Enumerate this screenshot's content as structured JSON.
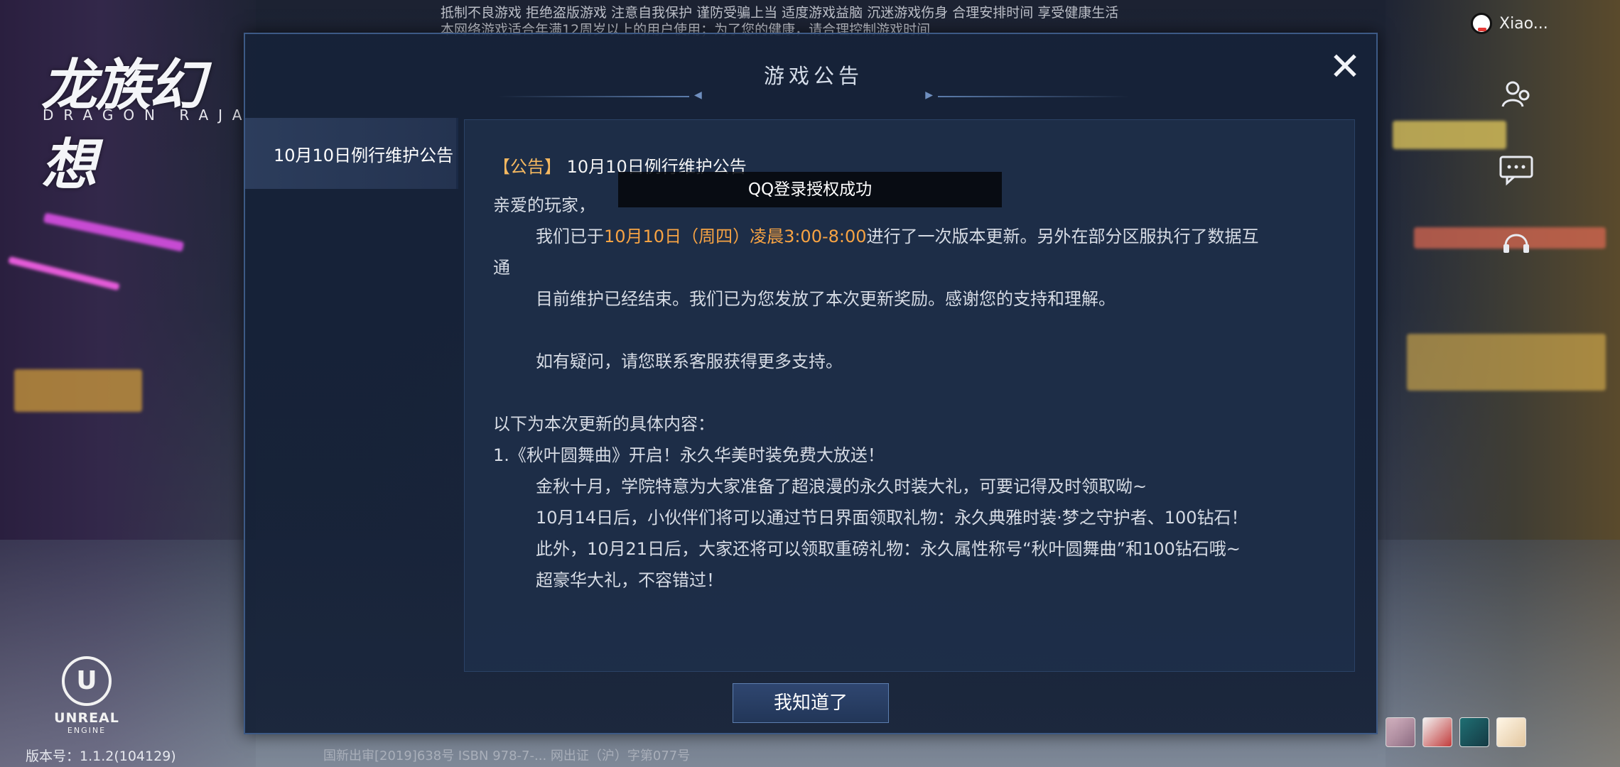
{
  "background": {
    "top_notice_line1": "抵制不良游戏 拒绝盗版游戏 注意自我保护 谨防受骗上当 适度游戏益脑 沉迷游戏伤身 合理安排时间 享受健康生活",
    "top_notice_line2": "本网络游戏适合年满12周岁以上的用户使用；为了您的健康，请合理控制游戏时间",
    "logo_main": "龙族幻想",
    "logo_sub": "DRAGON RAJA",
    "user_name": "Xiao...",
    "engine_logo_text": "UNREAL",
    "engine_logo_sub": "ENGINE",
    "version": "版本号：1.1.2(104129)",
    "bottom_notice": "国新出审[2019]638号  ISBN 978-7-...  网出证（沪）字第077号"
  },
  "side_icons": [
    "friends-icon",
    "chat-icon",
    "headset-icon"
  ],
  "dialog": {
    "title": "游戏公告",
    "tabs": [
      {
        "label": "10月10日例行维护公告",
        "selected": true
      }
    ],
    "notice_title_bracket_open": "【",
    "notice_title_tag": "公告",
    "notice_title_bracket_close": "】",
    "notice_title_text": "10月10日例行维护公告",
    "greeting": "亲爱的玩家，",
    "para1_pre": "我们已于",
    "para1_highlight": "10月10日（周四）凌晨3:00-8:00",
    "para1_post": "进行了一次版本更新。另外在部分区服执行了数据互",
    "para1_wrap": "通",
    "para2": "目前维护已经结束。我们已为您发放了本次更新奖励。感谢您的支持和理解。",
    "para3": "如有疑问，请您联系客服获得更多支持。",
    "list_intro": "以下为本次更新的具体内容：",
    "item1_title": "1.《秋叶圆舞曲》开启！永久华美时装免费大放送！",
    "item1_line1": "金秋十月，学院特意为大家准备了超浪漫的永久时装大礼，可要记得及时领取呦~",
    "item1_line2": "10月14日后，小伙伴们将可以通过节日界面领取礼物：永久典雅时装·梦之守护者、100钻石！",
    "item1_line3": "此外，10月21日后，大家还将可以领取重磅礼物：永久属性称号“秋叶圆舞曲”和100钻石哦~",
    "item1_line4": "超豪华大礼，不容错过！",
    "confirm_label": "我知道了"
  },
  "toast": {
    "text": "QQ登录授权成功"
  },
  "colors": {
    "highlight": "#f7a343",
    "dialog_border": "#3d5a86",
    "panel_bg": "#1e2f4a"
  }
}
